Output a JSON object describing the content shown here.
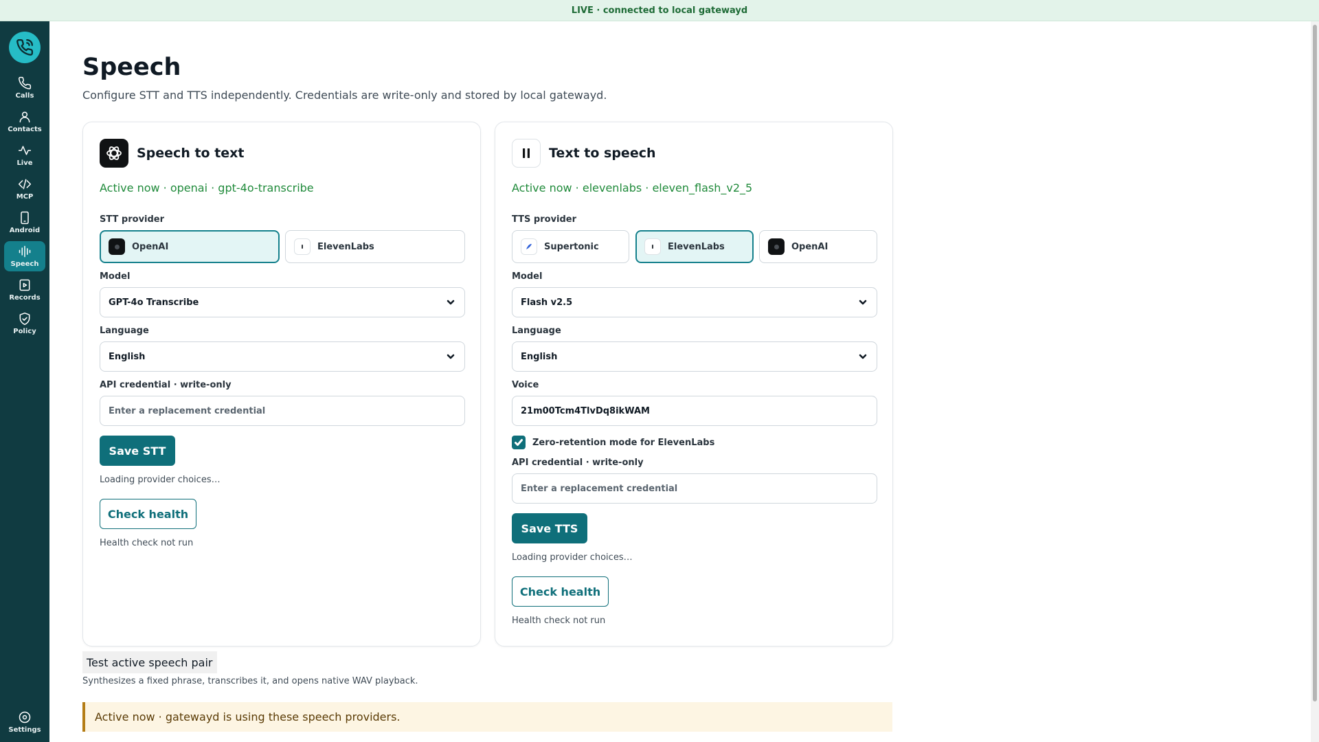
{
  "status_bar": {
    "text": "LIVE · connected to local gatewayd"
  },
  "sidebar": {
    "logo_icon": "phone-icon",
    "items": [
      {
        "label": "Calls",
        "icon": "phone-icon"
      },
      {
        "label": "Contacts",
        "icon": "user-icon"
      },
      {
        "label": "Live",
        "icon": "activity-icon"
      },
      {
        "label": "MCP",
        "icon": "code-icon"
      },
      {
        "label": "Android",
        "icon": "smartphone-icon"
      },
      {
        "label": "Speech",
        "icon": "waveform-icon",
        "active": true
      },
      {
        "label": "Records",
        "icon": "play-file-icon"
      },
      {
        "label": "Policy",
        "icon": "shield-check-icon"
      }
    ],
    "settings": {
      "label": "Settings",
      "icon": "gear-icon"
    }
  },
  "page": {
    "title": "Speech",
    "subtitle": "Configure STT and TTS independently. Credentials are write-only and stored by local gatewayd."
  },
  "stt": {
    "title": "Speech to text",
    "icon": "openai-icon",
    "active": "Active now · openai · gpt-4o-transcribe",
    "provider_label": "STT provider",
    "providers": [
      {
        "label": "OpenAI",
        "selected": true
      },
      {
        "label": "ElevenLabs",
        "selected": false
      }
    ],
    "model_label": "Model",
    "model_value": "GPT-4o Transcribe",
    "language_label": "Language",
    "language_value": "English",
    "credential_label": "API credential · write-only",
    "credential_placeholder": "Enter a replacement credential",
    "save_label": "Save STT",
    "loading_text": "Loading provider choices…",
    "health_button": "Check health",
    "health_status": "Health check not run"
  },
  "tts": {
    "title": "Text to speech",
    "icon": "elevenlabs-icon",
    "active": "Active now · elevenlabs · eleven_flash_v2_5",
    "provider_label": "TTS provider",
    "providers": [
      {
        "label": "Supertonic",
        "selected": false
      },
      {
        "label": "ElevenLabs",
        "selected": true
      },
      {
        "label": "OpenAI",
        "selected": false
      }
    ],
    "model_label": "Model",
    "model_value": "Flash v2.5",
    "language_label": "Language",
    "language_value": "English",
    "voice_label": "Voice",
    "voice_value": "21m00Tcm4TlvDq8ikWAM",
    "zero_retention_label": "Zero-retention mode for ElevenLabs",
    "zero_retention_checked": true,
    "credential_label": "API credential · write-only",
    "credential_placeholder": "Enter a replacement credential",
    "save_label": "Save TTS",
    "loading_text": "Loading provider choices…",
    "health_button": "Check health",
    "health_status": "Health check not run"
  },
  "test": {
    "title": "Test active speech pair",
    "subtitle": "Synthesizes a fixed phrase, transcribes it, and opens native WAV playback."
  },
  "banner": {
    "text": "Active now · gatewayd is using these speech providers."
  },
  "colors": {
    "sidebar_bg": "#103b41",
    "accent": "#0f6f7a",
    "active_green": "#1f8a3a",
    "status_bar_bg": "#e3f3ea",
    "banner_bg": "#fdf5e3",
    "banner_border": "#b47d16"
  }
}
